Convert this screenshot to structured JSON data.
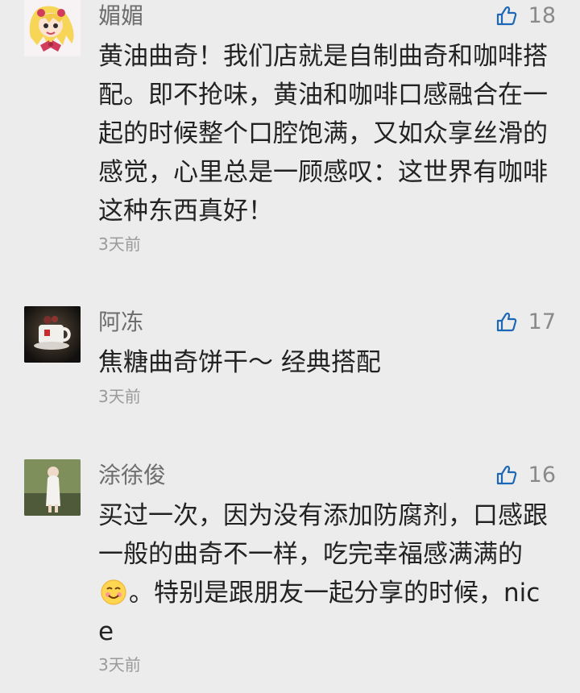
{
  "comments": [
    {
      "name": "媚媚",
      "like_count": "18",
      "content": "黄油曲奇！我们店就是自制曲奇和咖啡搭配。即不抢味，黄油和咖啡口感融合在一起的时候整个口腔饱满，又如众享丝滑的感觉，心里总是一顾感叹：这世界有咖啡这种东西真好！",
      "timestamp": "3天前",
      "avatar_icon": "cartoon-avatar-icon"
    },
    {
      "name": "阿冻",
      "like_count": "17",
      "content": "焦糖曲奇饼干～ 经典搭配",
      "timestamp": "3天前",
      "avatar_icon": "coffee-cup-avatar-icon"
    },
    {
      "name": "涂徐俊",
      "like_count": "16",
      "content_before_emoji": "买过一次，因为没有添加防腐剂，口感跟一般的曲奇不一样，吃完幸福感满满的",
      "content_after_emoji": "。特别是跟朋友一起分享的时候，nice",
      "timestamp": "3天前",
      "avatar_icon": "person-photo-avatar-icon",
      "emoji_icon": "smiling-face-emoji-icon"
    }
  ],
  "colors": {
    "background": "#ececec",
    "name": "#6d6d6d",
    "content": "#222222",
    "timestamp": "#9a9a9a",
    "like_icon": "#1d67b7"
  }
}
